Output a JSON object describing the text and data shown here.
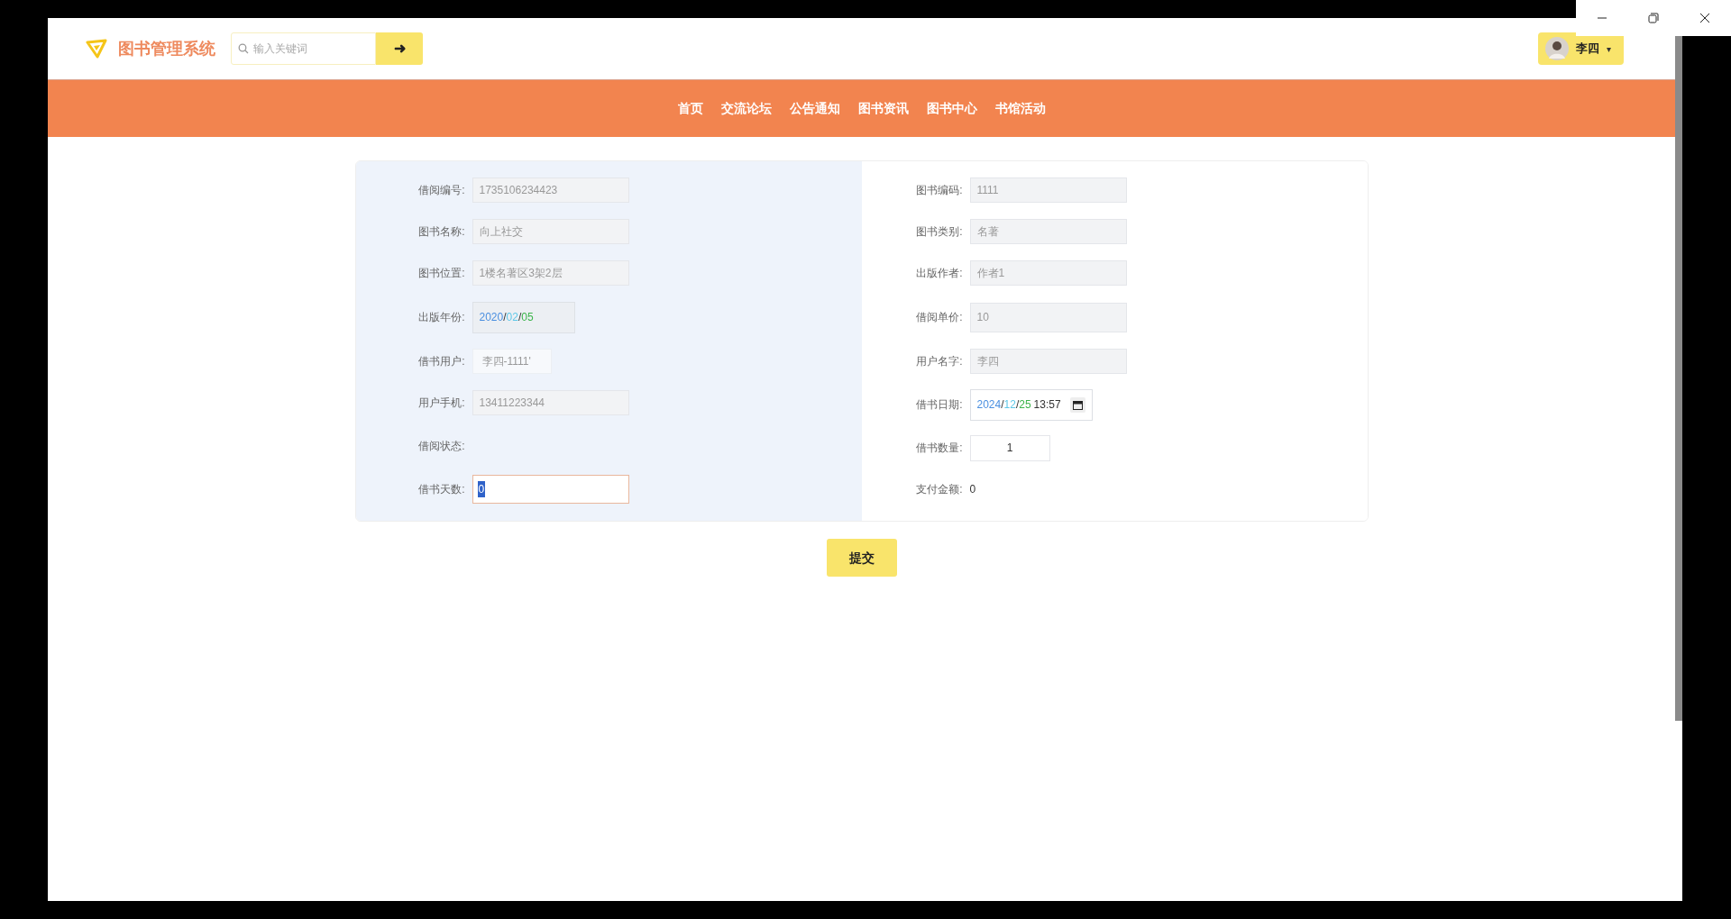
{
  "header": {
    "logo_title": "图书管理系统",
    "search": {
      "placeholder": "输入关键词"
    },
    "search_button": "➜",
    "user": {
      "name": "李四",
      "caret": "▾"
    }
  },
  "nav": [
    {
      "label": "首页"
    },
    {
      "label": "交流论坛"
    },
    {
      "label": "公告通知"
    },
    {
      "label": "图书资讯"
    },
    {
      "label": "图书中心"
    },
    {
      "label": "书馆活动"
    }
  ],
  "form": {
    "left": [
      {
        "label": "借阅编号:",
        "kind": "readonly",
        "value": "1735106234423"
      },
      {
        "label": "图书名称:",
        "kind": "readonly",
        "value": "向上社交"
      },
      {
        "label": "图书位置:",
        "kind": "readonly",
        "value": "1楼名著区3架2层"
      },
      {
        "label": "出版年份:",
        "kind": "date",
        "segments": [
          {
            "text": "2020",
            "color": "#4a8fe0"
          },
          {
            "text": "/"
          },
          {
            "text": "02",
            "color": "#5fc8e8"
          },
          {
            "text": "/"
          },
          {
            "text": "05",
            "color": "#3cb44b"
          }
        ]
      },
      {
        "label": "借书用户:",
        "kind": "select",
        "value": "李四-1111'"
      },
      {
        "label": "用户手机:",
        "kind": "readonly",
        "value": "13411223344"
      },
      {
        "label": "借阅状态:",
        "kind": "empty"
      },
      {
        "label": "借书天数:",
        "kind": "focused",
        "value": "0"
      }
    ],
    "right": [
      {
        "label": "图书编码:",
        "kind": "readonly",
        "value": "1111"
      },
      {
        "label": "图书类别:",
        "kind": "readonly",
        "value": "名著"
      },
      {
        "label": "出版作者:",
        "kind": "readonly",
        "value": "作者1"
      },
      {
        "label": "借阅单价:",
        "kind": "readonly_tall",
        "value": "10"
      },
      {
        "label": "用户名字:",
        "kind": "readonly",
        "value": "李四"
      },
      {
        "label": "借书日期:",
        "kind": "datetime",
        "segments": [
          {
            "text": "2024",
            "color": "#4a8fe0"
          },
          {
            "text": "/"
          },
          {
            "text": "12",
            "color": "#5fc8e8"
          },
          {
            "text": "/"
          },
          {
            "text": "25",
            "color": "#3cb44b"
          },
          {
            "text": "13:57"
          }
        ]
      },
      {
        "label": "借书数量:",
        "kind": "number",
        "value": "1"
      },
      {
        "label": "支付金额:",
        "kind": "text",
        "value": "0"
      }
    ]
  },
  "submit": "提交"
}
